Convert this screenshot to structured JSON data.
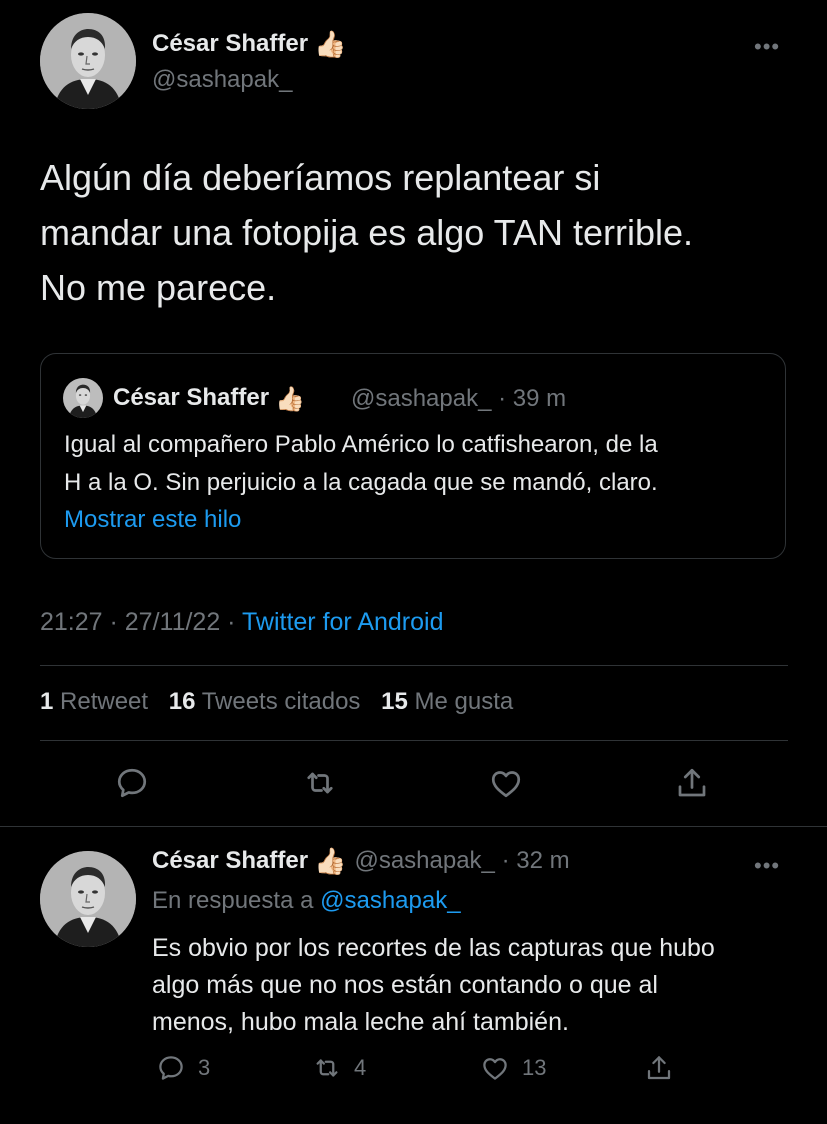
{
  "main_tweet": {
    "display_name": "César Shaffer",
    "verified_emoji": "👍🏻",
    "handle": "@sashapak_",
    "text_lines": [
      "Algún día deberíamos replantear si",
      "mandar una fotopija es algo TAN terrible.",
      "No me parece."
    ],
    "quoted": {
      "display_name": "César Shaffer",
      "verified_emoji": "👍🏻",
      "meta": "@sashapak_ · 39 m",
      "text_lines": [
        "Igual al compañero Pablo Américo lo catfishearon, de la",
        "H a la O. Sin perjuicio a la cagada que se mandó, claro."
      ],
      "show_thread": "Mostrar este hilo"
    },
    "timestamp": "21:27 · 27/11/22 · ",
    "source": "Twitter for Android",
    "stats": {
      "retweets_count": "1",
      "retweets_label": "Retweet",
      "quotes_count": "16",
      "quotes_label": "Tweets citados",
      "likes_count": "15",
      "likes_label": "Me gusta"
    },
    "actions": [
      "reply-icon",
      "retweet-icon",
      "like-icon",
      "share-icon"
    ]
  },
  "reply": {
    "display_name": "César Shaffer",
    "verified_emoji": "👍🏻",
    "meta": "@sashapak_ · 32 m",
    "reply_to_prefix": "En respuesta a ",
    "reply_to_handle": "@sashapak_",
    "text_lines": [
      "Es obvio por los recortes de las capturas que hubo",
      "algo más que no nos están contando o que al",
      "menos, hubo mala leche ahí también."
    ],
    "replies": "3",
    "retweets": "4",
    "likes": "13"
  },
  "colors": {
    "background": "#000000",
    "text": "#e7e9ea",
    "secondary": "#71767b",
    "accent": "#1d9bf0",
    "border": "#2f3336"
  }
}
